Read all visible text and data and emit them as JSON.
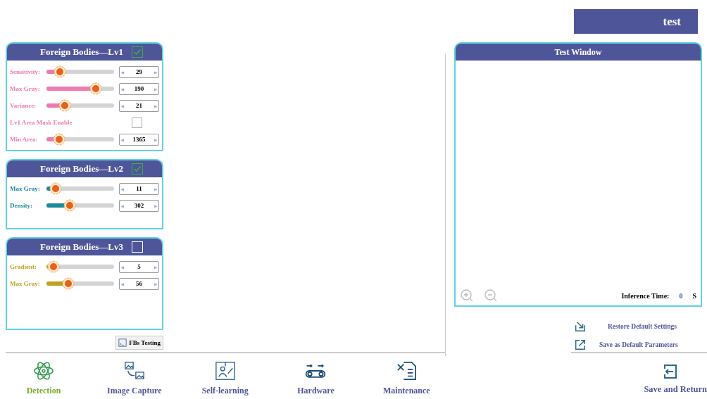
{
  "top_button": {
    "label": "test"
  },
  "panels": [
    {
      "title": "Foreign Bodies—Lv1",
      "enabled": true,
      "color": "#f07ab0",
      "rows": [
        {
          "kind": "slider",
          "label": "Sensitivity:",
          "level": 0.2,
          "value": "29",
          "left": "«",
          "right": "»"
        },
        {
          "kind": "slider",
          "label": "Max Gray:",
          "level": 0.73,
          "value": "190",
          "left": "«",
          "right": "»"
        },
        {
          "kind": "slider",
          "label": "Variance:",
          "level": 0.27,
          "value": "21",
          "left": "«",
          "right": "»"
        },
        {
          "kind": "checkbox",
          "label": "Lv1 Area Mask Enable",
          "checked": false
        },
        {
          "kind": "slider",
          "label": "Min Area:",
          "level": 0.19,
          "value": "1365",
          "left": "«",
          "right": "»"
        }
      ]
    },
    {
      "title": "Foreign Bodies—Lv2",
      "enabled": true,
      "color": "#1a8a9a",
      "rows": [
        {
          "kind": "slider",
          "label": "Max Gray:",
          "level": 0.13,
          "value": "11",
          "left": "«",
          "right": "»"
        },
        {
          "kind": "slider",
          "label": "Density:",
          "level": 0.34,
          "value": "302",
          "left": "«",
          "right": "»"
        }
      ]
    },
    {
      "title": "Foreign Bodies—Lv3",
      "enabled": false,
      "color": "#c0a020",
      "rows": [
        {
          "kind": "slider",
          "label": "Gradient:",
          "level": 0.1,
          "value": "5",
          "left": "«",
          "right": "»"
        },
        {
          "kind": "slider",
          "label": "Max Gray:",
          "level": 0.32,
          "value": "56",
          "left": "«",
          "right": "»"
        }
      ]
    }
  ],
  "fbs_testing": {
    "label": "FBs Testing"
  },
  "test_window": {
    "title": "Test Window",
    "inference_label": "Inference Time:",
    "inference_value": "0",
    "inference_unit": "S"
  },
  "actions": [
    {
      "kind": "restore",
      "label": "Restore Default Settings"
    },
    {
      "kind": "save",
      "label": "Save as Default Parameters"
    }
  ],
  "nav": [
    {
      "kind": "detection",
      "label": "Detection",
      "selected": true
    },
    {
      "kind": "capture",
      "label": "Image Capture",
      "selected": false
    },
    {
      "kind": "learning",
      "label": "Self-learning",
      "selected": false
    },
    {
      "kind": "hardware",
      "label": "Hardware",
      "selected": false
    },
    {
      "kind": "maintenance",
      "label": "Maintenance",
      "selected": false
    }
  ],
  "save_return": {
    "label": "Save and Return"
  }
}
